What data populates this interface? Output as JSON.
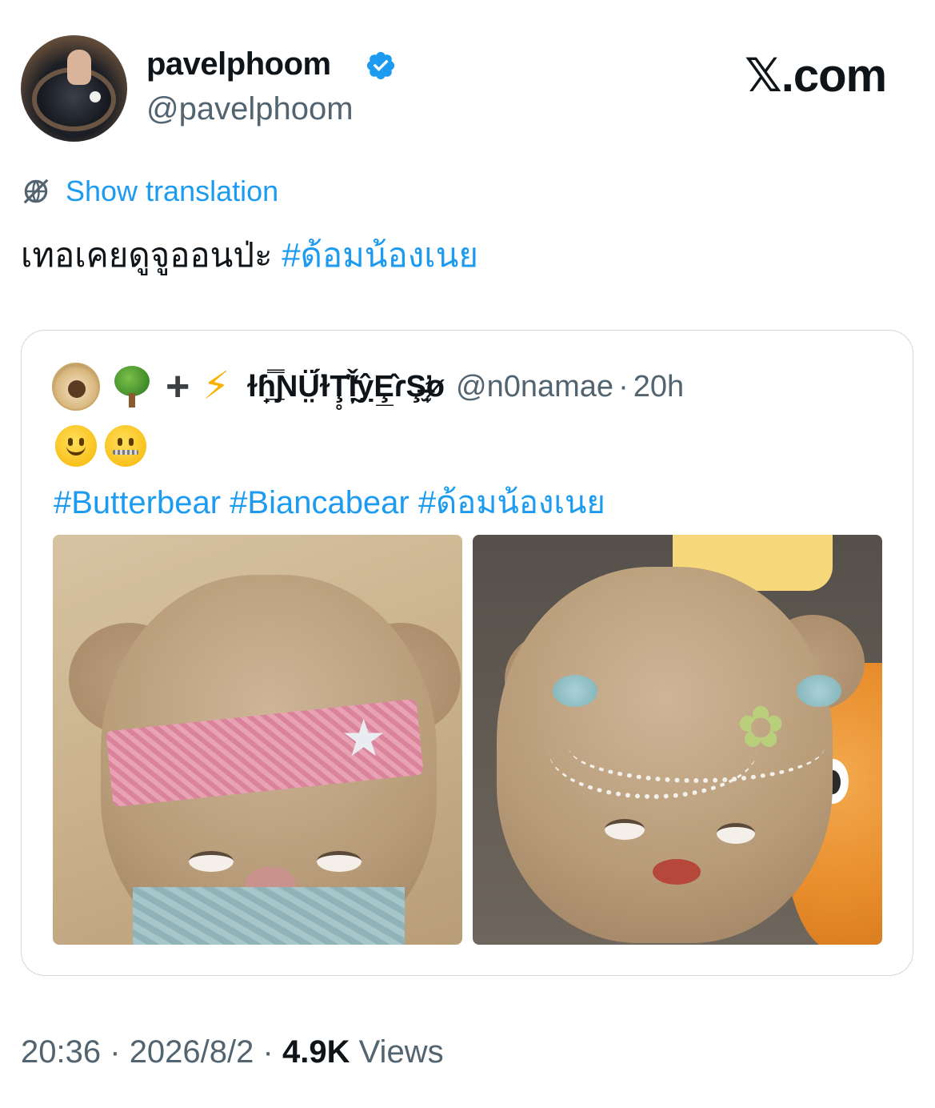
{
  "post": {
    "author_name": "pavelphoom",
    "author_handle": "@pavelphoom",
    "site_label": "𝕏.com",
    "show_translation": "Show translation",
    "text": "เทอเคยดูจูออนป่ะ",
    "hashtag": "#ด้อมน้องเนย"
  },
  "quote": {
    "display_name": "ɫɦ̟̲̿ƝṲ̈́̈́ɫŢ̥̇̍Ǐ̦̰̒ỵ̂Ȩ̲̂ɾŞ̶̛̫̘ø",
    "handle": "@n0namae",
    "time_sep": "·",
    "time": "20h",
    "tags": "#Butterbear #Biancabear #ด้อมน้องเนย"
  },
  "footer": {
    "time": "20:36",
    "sep1": "·",
    "date": "2026/8/2",
    "sep2": "·",
    "views_count": "4.9K",
    "views_label": "Views"
  },
  "colors": {
    "accent": "#1d9bf0",
    "text_primary": "#0f1419",
    "text_secondary": "#536471",
    "border": "#cfd9de"
  },
  "icons": {
    "verified": "verified-badge-icon",
    "translate": "translate-globe-icon"
  }
}
